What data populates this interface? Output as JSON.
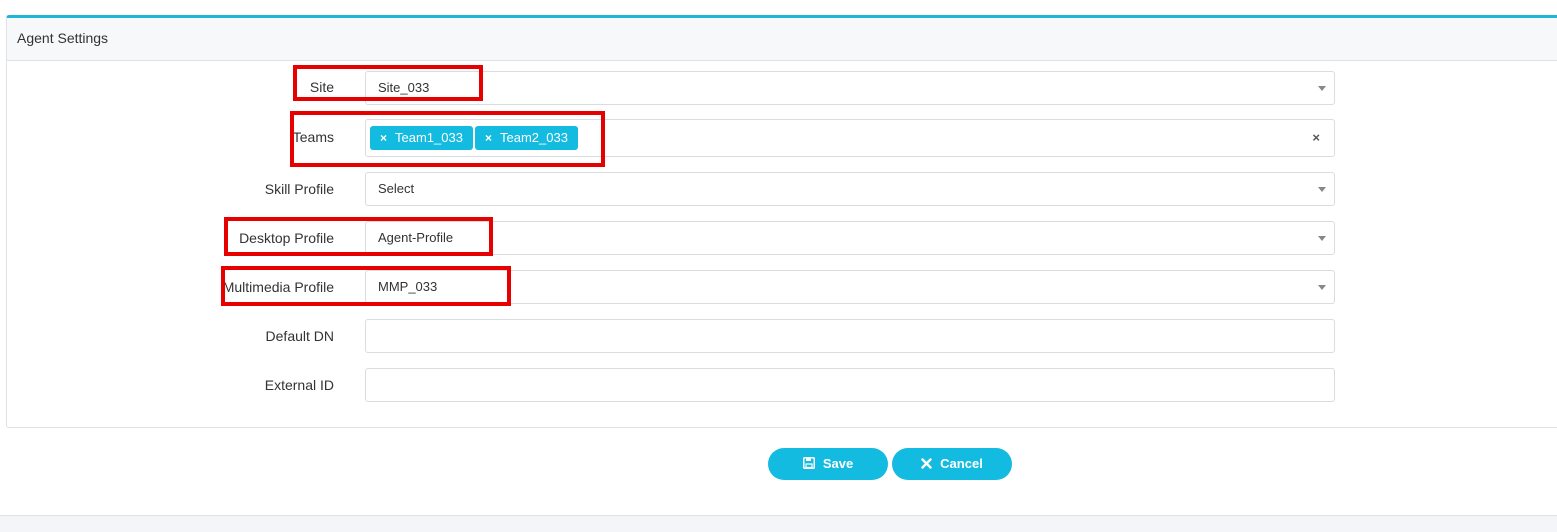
{
  "panel": {
    "title": "Agent Settings"
  },
  "fields": {
    "site": {
      "label": "Site",
      "value": "Site_033"
    },
    "teams": {
      "label": "Teams",
      "tags": [
        "Team1_033",
        "Team2_033"
      ],
      "tag_remove": "×",
      "clear": "×"
    },
    "skill_profile": {
      "label": "Skill Profile",
      "value": "Select"
    },
    "desktop_profile": {
      "label": "Desktop Profile",
      "value": "Agent-Profile"
    },
    "multimedia_profile": {
      "label": "Multimedia Profile",
      "value": "MMP_033"
    },
    "default_dn": {
      "label": "Default DN",
      "value": ""
    },
    "external_id": {
      "label": "External ID",
      "value": ""
    }
  },
  "actions": {
    "save_label": "Save",
    "cancel_label": "Cancel"
  },
  "colors": {
    "accent": "#14bbe0",
    "highlight": "#e60000",
    "border_top": "#1fb5d6"
  },
  "icons": {
    "save": "floppy-disk-icon",
    "cancel": "close-icon",
    "dropdown": "chevron-down-icon"
  }
}
